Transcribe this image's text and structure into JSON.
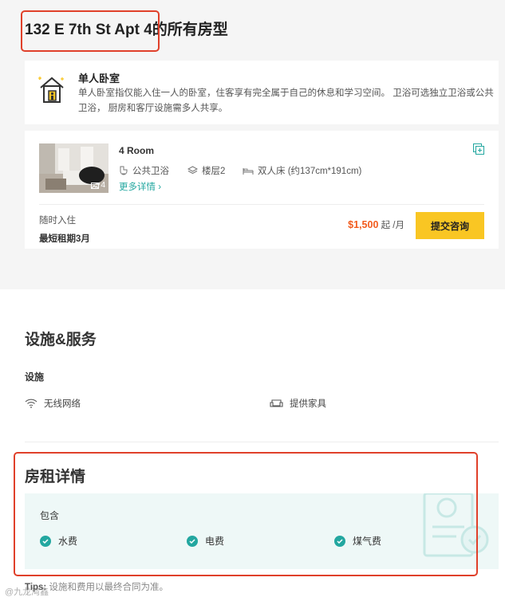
{
  "header": {
    "title": "132 E 7th St Apt 4的所有房型"
  },
  "room_type": {
    "name": "单人卧室",
    "description": "单人卧室指仅能入住一人的卧室，住客享有完全属于自己的休息和学习空间。 卫浴可选独立卫浴或公共卫浴， 厨房和客厅设施需多人共享。",
    "icon": "house-with-person-icon"
  },
  "room": {
    "name": "4 Room",
    "photo_count": "4",
    "features": {
      "bathroom": "公共卫浴",
      "floor": "楼层2",
      "bed": "双人床 (约137cm*191cm)"
    },
    "more_link": "更多详情 ›",
    "availability": "随时入住",
    "min_term": "最短租期3月",
    "price_amount": "$1,500",
    "price_suffix": " 起 /月",
    "consult_button": "提交咨询"
  },
  "facilities": {
    "title": "设施&服务",
    "subtitle": "设施",
    "items": [
      {
        "label": "无线网络",
        "icon": "wifi-icon"
      },
      {
        "label": "提供家具",
        "icon": "sofa-icon"
      }
    ]
  },
  "rent": {
    "title": "房租详情",
    "included_label": "包含",
    "included": [
      {
        "label": "水费"
      },
      {
        "label": "电费"
      },
      {
        "label": "煤气费"
      }
    ]
  },
  "tips": {
    "prefix": "Tips:",
    "text": " 设施和费用以最终合同为准。"
  },
  "watermark": "@九龙湾鑫",
  "colors": {
    "accent": "#23a7a0",
    "price": "#f25b1d",
    "button": "#f9c623",
    "highlight": "#e0402a"
  }
}
